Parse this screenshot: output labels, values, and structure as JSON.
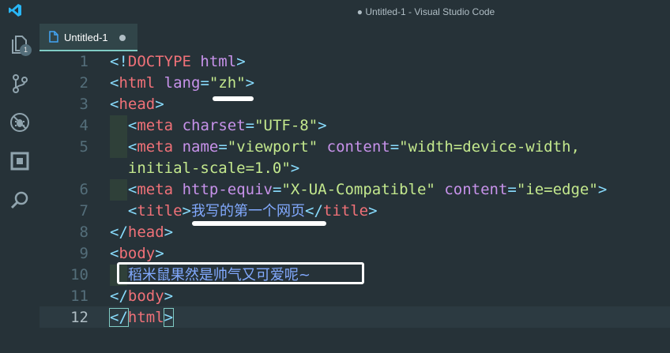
{
  "window": {
    "title": "● Untitled-1 - Visual Studio Code"
  },
  "activity_bar": {
    "items": [
      {
        "name": "explorer",
        "icon": "files-icon",
        "badge": "1"
      },
      {
        "name": "source-control",
        "icon": "source-control-icon"
      },
      {
        "name": "debug",
        "icon": "debug-icon"
      },
      {
        "name": "extensions",
        "icon": "extensions-icon"
      },
      {
        "name": "search",
        "icon": "search-icon"
      }
    ],
    "logo_icon": "vscode-logo-icon"
  },
  "tabs": [
    {
      "label": "Untitled-1",
      "dirty": true
    }
  ],
  "editor": {
    "active_line": 12,
    "lines": [
      {
        "num": "1",
        "tokens": [
          [
            "p",
            "<!"
          ],
          [
            "t",
            "DOCTYPE"
          ],
          [
            "d",
            " "
          ],
          [
            "a",
            "html"
          ],
          [
            "p",
            ">"
          ]
        ]
      },
      {
        "num": "2",
        "tokens": [
          [
            "p",
            "<"
          ],
          [
            "t",
            "html"
          ],
          [
            "d",
            " "
          ],
          [
            "a",
            "lang"
          ],
          [
            "p",
            "="
          ],
          [
            "s",
            "\"zh\""
          ],
          [
            "p",
            ">"
          ]
        ]
      },
      {
        "num": "3",
        "tokens": [
          [
            "p",
            "<"
          ],
          [
            "t",
            "head"
          ],
          [
            "p",
            ">"
          ]
        ]
      },
      {
        "num": "4",
        "tokens": [
          [
            "d",
            "  "
          ],
          [
            "p",
            "<"
          ],
          [
            "t",
            "meta"
          ],
          [
            "d",
            " "
          ],
          [
            "a",
            "charset"
          ],
          [
            "p",
            "="
          ],
          [
            "s",
            "\"UTF-8\""
          ],
          [
            "p",
            ">"
          ]
        ]
      },
      {
        "num": "5",
        "tokens": [
          [
            "d",
            "  "
          ],
          [
            "p",
            "<"
          ],
          [
            "t",
            "meta"
          ],
          [
            "d",
            " "
          ],
          [
            "a",
            "name"
          ],
          [
            "p",
            "="
          ],
          [
            "s",
            "\"viewport\""
          ],
          [
            "d",
            " "
          ],
          [
            "a",
            "content"
          ],
          [
            "p",
            "="
          ],
          [
            "s",
            "\"width=device-width,"
          ]
        ]
      },
      {
        "num": "",
        "tokens": [
          [
            "s",
            "  initial-scale=1.0\""
          ],
          [
            "p",
            ">"
          ]
        ]
      },
      {
        "num": "6",
        "tokens": [
          [
            "d",
            "  "
          ],
          [
            "p",
            "<"
          ],
          [
            "t",
            "meta"
          ],
          [
            "d",
            " "
          ],
          [
            "a",
            "http-equiv"
          ],
          [
            "p",
            "="
          ],
          [
            "s",
            "\"X-UA-Compatible\""
          ],
          [
            "d",
            " "
          ],
          [
            "a",
            "content"
          ],
          [
            "p",
            "="
          ],
          [
            "s",
            "\"ie=edge\""
          ],
          [
            "p",
            ">"
          ]
        ]
      },
      {
        "num": "7",
        "tokens": [
          [
            "d",
            "  "
          ],
          [
            "p",
            "<"
          ],
          [
            "t",
            "title"
          ],
          [
            "p",
            ">"
          ],
          [
            "cn",
            "我写的第一个网页"
          ],
          [
            "p",
            "</"
          ],
          [
            "t",
            "title"
          ],
          [
            "p",
            ">"
          ]
        ]
      },
      {
        "num": "8",
        "tokens": [
          [
            "p",
            "</"
          ],
          [
            "t",
            "head"
          ],
          [
            "p",
            ">"
          ]
        ]
      },
      {
        "num": "9",
        "tokens": [
          [
            "p",
            "<"
          ],
          [
            "t",
            "body"
          ],
          [
            "p",
            ">"
          ]
        ]
      },
      {
        "num": "10",
        "tokens": [
          [
            "d",
            "  "
          ],
          [
            "cn",
            "稻米鼠果然是帅气又可爱呢~"
          ]
        ]
      },
      {
        "num": "11",
        "tokens": [
          [
            "p",
            "</"
          ],
          [
            "t",
            "body"
          ],
          [
            "p",
            ">"
          ]
        ]
      },
      {
        "num": "12",
        "tokens": [
          [
            "p",
            "</"
          ],
          [
            "t",
            "html"
          ],
          [
            "p",
            ">"
          ]
        ]
      }
    ]
  }
}
